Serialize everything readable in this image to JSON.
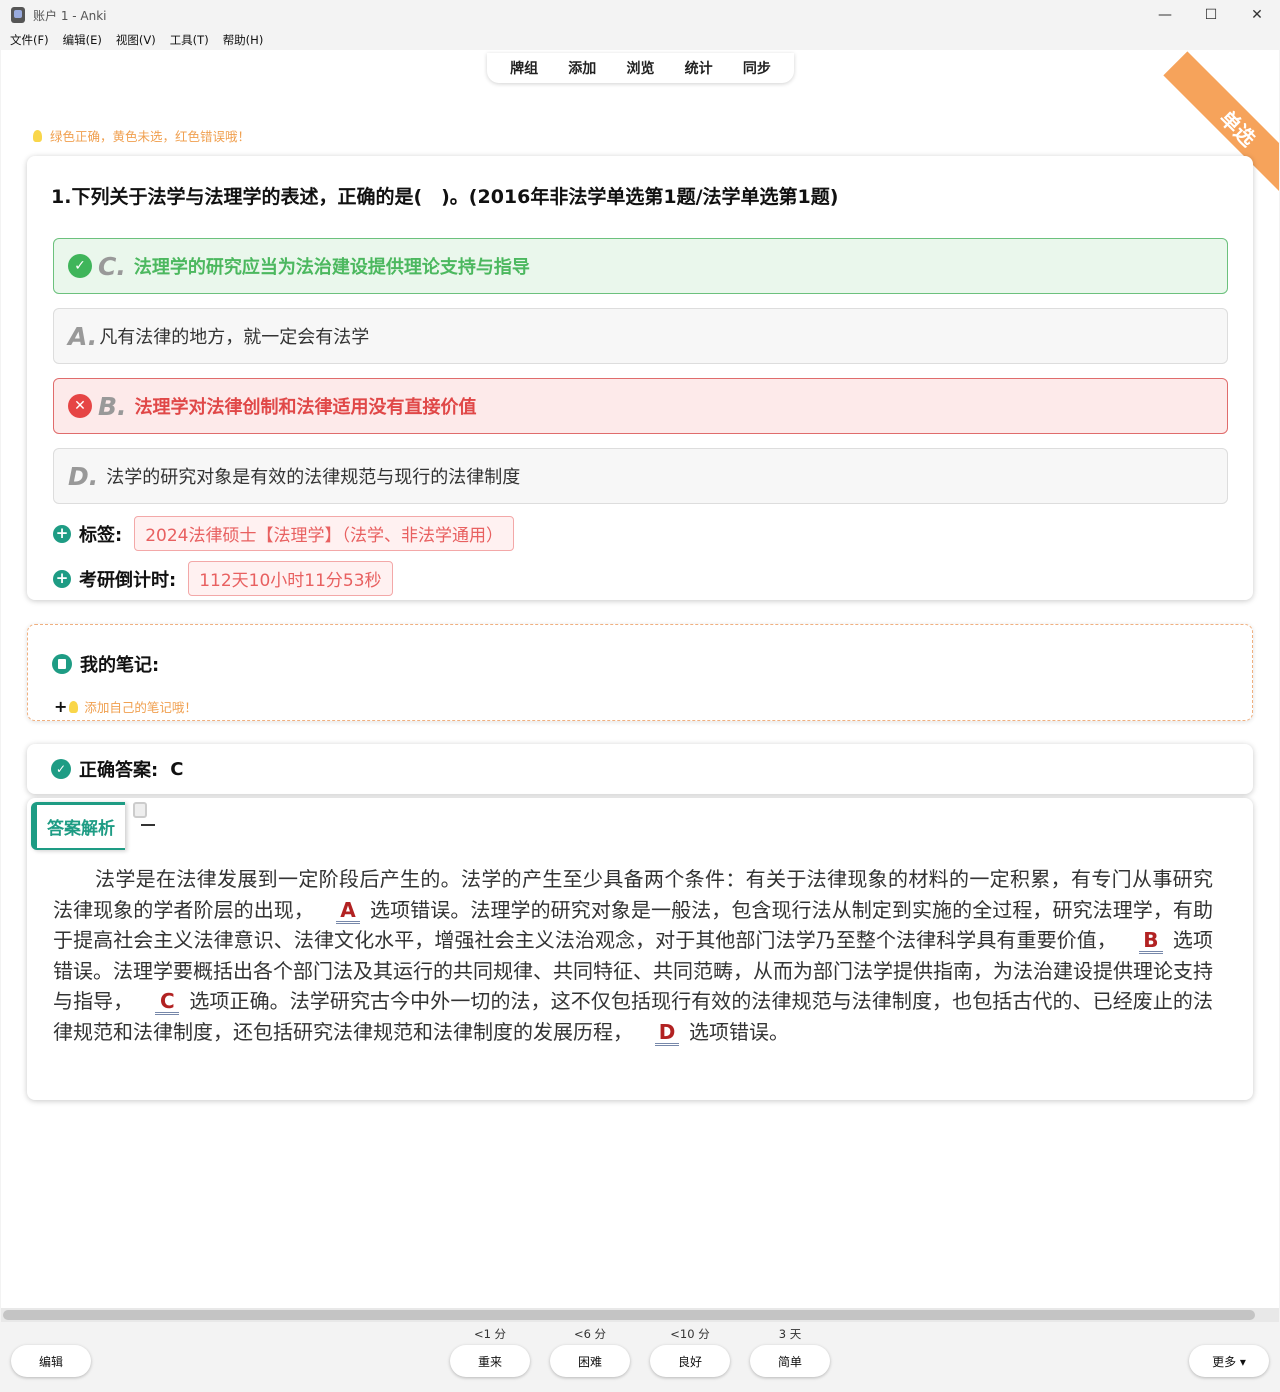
{
  "window": {
    "title": "账户 1 - Anki",
    "controls": {
      "minimize": "—",
      "maximize": "☐",
      "close": "✕"
    }
  },
  "menu": [
    "文件(F)",
    "编辑(E)",
    "视图(V)",
    "工具(T)",
    "帮助(H)"
  ],
  "nav": [
    "牌组",
    "添加",
    "浏览",
    "统计",
    "同步"
  ],
  "ribbon": "单选",
  "hint": "绿色正确，黄色未选，红色错误哦！",
  "question": {
    "title": "1.下列关于法学与法理学的表述，正确的是(　)。(2016年非法学单选第1题/法学单选第1题)",
    "options": [
      {
        "letter": "C.",
        "text": "法理学的研究应当为法治建设提供理论支持与指导",
        "state": "correct"
      },
      {
        "letter": "A.",
        "text": "凡有法律的地方，就一定会有法学",
        "state": "normal"
      },
      {
        "letter": "B.",
        "text": "法理学对法律创制和法律适用没有直接价值",
        "state": "wrong"
      },
      {
        "letter": "D.",
        "text": "法学的研究对象是有效的法律规范与现行的法律制度",
        "state": "normal"
      }
    ],
    "tag_label": "标签:",
    "tag_value": "2024法律硕士【法理学】（法学、非法学通用）",
    "countdown_label": "考研倒计时:",
    "countdown_value": "112天10小时11分53秒"
  },
  "notes": {
    "title": "我的笔记:",
    "add_prefix": "+",
    "add_text": "添加自己的笔记哦！"
  },
  "answer": {
    "label": "正确答案:",
    "value": "C"
  },
  "explanation": {
    "tab_label": "答案解析",
    "parts": [
      "法学是在法律发展到一定阶段后产生的。法学的产生至少具备两个条件：有关于法律现象的材料的一定积累，有专门从事研究法律现象的学者阶层的出现，",
      "A",
      "选项错误。法理学的研究对象是一般法，包含现行法从制定到实施的全过程，研究法理学，有助于提高社会主义法律意识、法律文化水平，增强社会主义法治观念，对于其他部门法学乃至整个法律科学具有重要价值，",
      "B",
      "选项错误。法理学要概括出各个部门法及其运行的共同规律、共同特征、共同范畴，从而为部门法学提供指南，为法治建设提供理论支持与指导，",
      "C",
      "选项正确。法学研究古今中外一切的法，这不仅包括现行有效的法律规范与法律制度，也包括古代的、已经废止的法律规范和法律制度，还包括研究法律规范和法律制度的发展历程，",
      "D",
      "选项错误。"
    ]
  },
  "bottom": {
    "edit": "编辑",
    "more": "更多 ▾",
    "answers": [
      {
        "interval": "<1 分",
        "label": "重来"
      },
      {
        "interval": "<6 分",
        "label": "困难"
      },
      {
        "interval": "<10 分",
        "label": "良好"
      },
      {
        "interval": "3 天",
        "label": "简单"
      }
    ]
  },
  "colors": {
    "correct": "#4cb85f",
    "wrong": "#e04848",
    "accent": "#1e9c84",
    "ribbon": "#f6a35b"
  }
}
